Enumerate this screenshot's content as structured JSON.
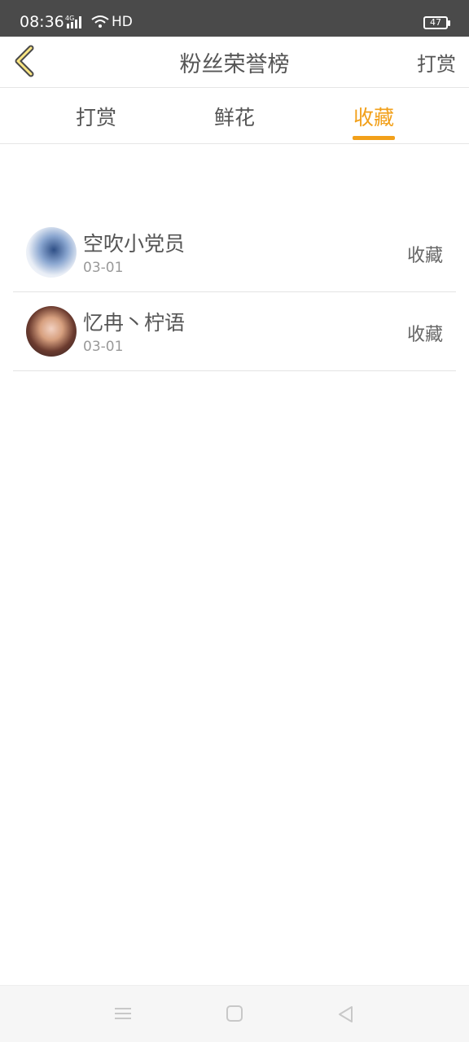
{
  "status_bar": {
    "time": "08:36",
    "network": "4G",
    "hd": "HD",
    "battery": "47"
  },
  "header": {
    "title": "粉丝荣誉榜",
    "right_action": "打赏",
    "back_icon": "chevron-left-icon",
    "accent": "#f2a01a"
  },
  "tabs": [
    {
      "label": "打赏"
    },
    {
      "label": "鲜花"
    },
    {
      "label": "收藏"
    }
  ],
  "active_tab": "收藏",
  "list": {
    "items": [
      {
        "name": "空吹小党员",
        "date": "03-01",
        "action": "收藏"
      },
      {
        "name": "忆冉丶柠语",
        "date": "03-01",
        "action": "收藏"
      }
    ]
  },
  "system_nav": {
    "menu_icon": "menu-icon",
    "home_icon": "home-icon",
    "back_icon": "back-triangle-icon"
  }
}
